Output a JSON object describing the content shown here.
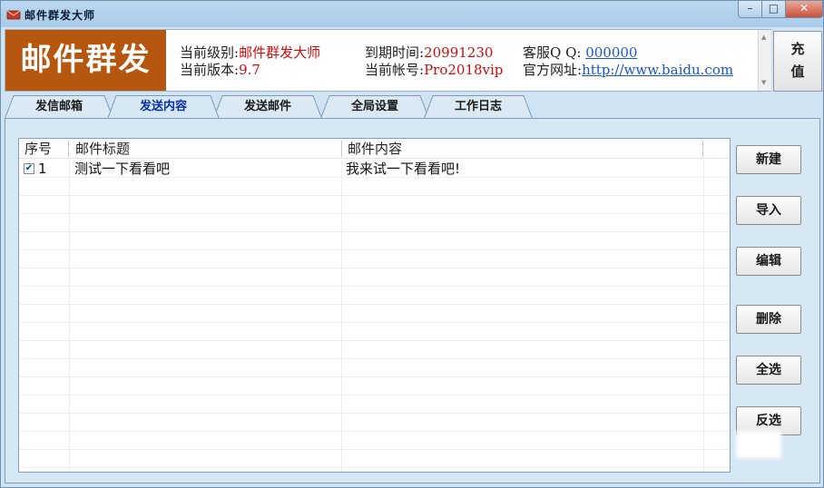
{
  "window": {
    "title": "邮件群发大师",
    "icon": "envelope-app-icon",
    "controls": {
      "minimize": "–",
      "maximize": "□",
      "close": "✕"
    }
  },
  "header": {
    "logo_text": "邮件群发",
    "level_label": "当前级别:",
    "level_value": "邮件群发大师",
    "version_label": "当前版本:",
    "version_value": "9.7",
    "expire_label": "到期时间:",
    "expire_value": "20991230",
    "account_label": "当前帐号:",
    "account_value": "Pro2018vip",
    "qq_label": "客服Q Q:",
    "qq_value": "000000",
    "website_label": "官方网址:",
    "website_value": "http://www.baidu.com",
    "recharge_line1": "充",
    "recharge_line2": "值"
  },
  "tabs": [
    {
      "label": "发信邮箱",
      "active": false
    },
    {
      "label": "发送内容",
      "active": true
    },
    {
      "label": "发送邮件",
      "active": false
    },
    {
      "label": "全局设置",
      "active": false
    },
    {
      "label": "工作日志",
      "active": false
    }
  ],
  "list": {
    "columns": [
      "序号",
      "邮件标题",
      "邮件内容"
    ],
    "rows": [
      {
        "checked": true,
        "index": "1",
        "subject": "测试一下看看吧",
        "content": "我来试一下看看吧!"
      }
    ]
  },
  "side_buttons": {
    "new": "新建",
    "import": "导入",
    "edit": "编辑",
    "delete": "删除",
    "select_all": "全选",
    "invert": "反选"
  },
  "colors": {
    "logo_bg": "#b5570f",
    "value_red": "#d20b0b",
    "link_blue": "#1b57c5",
    "active_tab_text": "#0b2fa8",
    "panel_bg": "#d7e8f5"
  }
}
